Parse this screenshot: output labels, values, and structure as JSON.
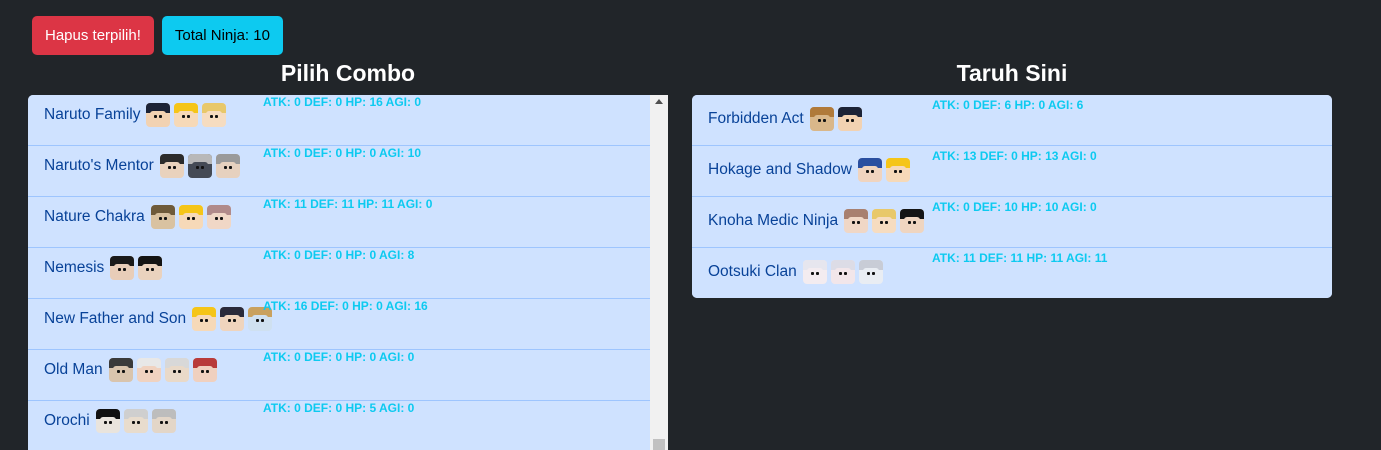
{
  "toolbar": {
    "delete_label": "Hapus terpilih!",
    "total_label": "Total Ninja: 10"
  },
  "left_panel": {
    "title": "Pilih Combo",
    "items": [
      {
        "name": "Naruto Family",
        "stats": "ATK: 0 DEF: 0 HP: 16 AGI: 0",
        "ninjas": [
          {
            "hair": "#1c2336",
            "face": "#f2d2b2"
          },
          {
            "hair": "#f5c518",
            "face": "#f6d9b8"
          },
          {
            "hair": "#e8c86a",
            "face": "#f6dcc0"
          }
        ]
      },
      {
        "name": "Naruto's Mentor",
        "stats": "ATK: 0 DEF: 0 HP: 0 AGI: 10",
        "ninjas": [
          {
            "hair": "#2b2b2b",
            "face": "#e9d2bd"
          },
          {
            "hair": "#b8b8b8",
            "face": "#444a55"
          },
          {
            "hair": "#9a9a9a",
            "face": "#e6d1bf"
          }
        ]
      },
      {
        "name": "Nature Chakra",
        "stats": "ATK: 11 DEF: 11 HP: 11 AGI: 0",
        "ninjas": [
          {
            "hair": "#6e5a3a",
            "face": "#d9c2a1"
          },
          {
            "hair": "#f5c518",
            "face": "#f6d9b8"
          },
          {
            "hair": "#b08a8a",
            "face": "#f0d7c6"
          }
        ]
      },
      {
        "name": "Nemesis",
        "stats": "ATK: 0 DEF: 0 HP: 0 AGI: 8",
        "ninjas": [
          {
            "hair": "#1a1a1a",
            "face": "#e8cdb8"
          },
          {
            "hair": "#141414",
            "face": "#ead2be"
          }
        ]
      },
      {
        "name": "New Father and Son",
        "stats": "ATK: 16 DEF: 0 HP: 0 AGI: 16",
        "ninjas": [
          {
            "hair": "#f5c518",
            "face": "#f6d9b8"
          },
          {
            "hair": "#2a2a3a",
            "face": "#efd4bd"
          },
          {
            "hair": "#c9a15e",
            "face": "#cfe0f0"
          }
        ]
      },
      {
        "name": "Old Man",
        "stats": "ATK: 0 DEF: 0 HP: 0 AGI: 0",
        "ninjas": [
          {
            "hair": "#3a3a3a",
            "face": "#d9c4ad"
          },
          {
            "hair": "#e8e8e8",
            "face": "#f0d2c0"
          },
          {
            "hair": "#d8d8d8",
            "face": "#e9d9c8"
          },
          {
            "hair": "#b83a3a",
            "face": "#f0d0bf"
          }
        ]
      },
      {
        "name": "Orochi",
        "stats": "ATK: 0 DEF: 0 HP: 5 AGI: 0",
        "ninjas": [
          {
            "hair": "#111111",
            "face": "#e9e4dd"
          },
          {
            "hair": "#cfcfcf",
            "face": "#e8dccd"
          },
          {
            "hair": "#bdbdbd",
            "face": "#e3d6c8"
          }
        ]
      }
    ]
  },
  "right_panel": {
    "title": "Taruh Sini",
    "items": [
      {
        "name": "Forbidden Act",
        "stats": "ATK: 0 DEF: 6 HP: 0 AGI: 6",
        "ninjas": [
          {
            "hair": "#b07a3a",
            "face": "#d9b78a"
          },
          {
            "hair": "#1c2336",
            "face": "#f2d2b2"
          }
        ]
      },
      {
        "name": "Hokage and Shadow",
        "stats": "ATK: 13 DEF: 0 HP: 13 AGI: 0",
        "ninjas": [
          {
            "hair": "#2a4fa0",
            "face": "#f0d4bf"
          },
          {
            "hair": "#f5c518",
            "face": "#f6d9b8"
          }
        ]
      },
      {
        "name": "Knoha Medic Ninja",
        "stats": "ATK: 0 DEF: 10 HP: 10 AGI: 0",
        "ninjas": [
          {
            "hair": "#a88070",
            "face": "#f0d7c6"
          },
          {
            "hair": "#e8c86a",
            "face": "#f6dcc0"
          },
          {
            "hair": "#151515",
            "face": "#efd5c0"
          }
        ]
      },
      {
        "name": "Ootsuki Clan",
        "stats": "ATK: 11 DEF: 11 HP: 11 AGI: 11",
        "ninjas": [
          {
            "hair": "#e6e6ee",
            "face": "#f3ecf0"
          },
          {
            "hair": "#dcdce6",
            "face": "#f2e6ea"
          },
          {
            "hair": "#c8ccd6",
            "face": "#e9edf3"
          }
        ]
      }
    ]
  }
}
